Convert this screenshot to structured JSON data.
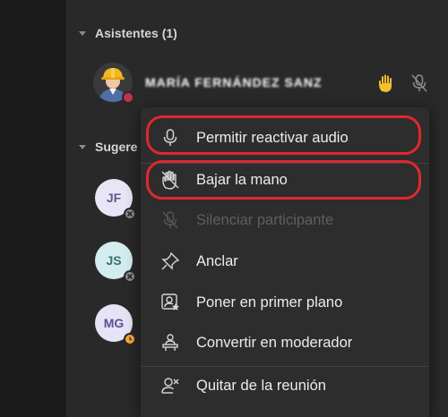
{
  "attendees_section": {
    "title": "Asistentes (1)",
    "attendee": {
      "name_blurred": "MARÍA FERNÁNDEZ SANZ",
      "status_color": "#c4314b"
    }
  },
  "suggestions_section": {
    "title_visible": "Sugere",
    "people": [
      {
        "initials": "JF",
        "bg": "#e8e6f6",
        "fg": "#5b5a8f",
        "badge": "x"
      },
      {
        "initials": "JS",
        "bg": "#d3ecee",
        "fg": "#3a6f75",
        "badge": "x"
      },
      {
        "initials": "MG",
        "bg": "#e6e3f7",
        "fg": "#56528f",
        "badge": "clock"
      }
    ]
  },
  "context_menu": {
    "items": [
      {
        "label": "Permitir reactivar audio",
        "icon": "mic-icon",
        "disabled": false,
        "highlighted": true
      },
      {
        "label": "Bajar la mano",
        "icon": "lower-hand-icon",
        "disabled": false,
        "highlighted": true
      },
      {
        "label": "Silenciar participante",
        "icon": "mic-off-icon",
        "disabled": true,
        "highlighted": false
      },
      {
        "label": "Anclar",
        "icon": "pin-icon",
        "disabled": false,
        "highlighted": false
      },
      {
        "label": "Poner en primer plano",
        "icon": "spotlight-icon",
        "disabled": false,
        "highlighted": false
      },
      {
        "label": "Convertir en moderador",
        "icon": "presenter-icon",
        "disabled": false,
        "highlighted": false
      },
      {
        "label": "Quitar de la reunión",
        "icon": "remove-person-icon",
        "disabled": false,
        "highlighted": false
      }
    ]
  },
  "colors": {
    "highlight": "#e1272f",
    "raise_hand": "#f2c12e",
    "away": "#f8a73a"
  }
}
